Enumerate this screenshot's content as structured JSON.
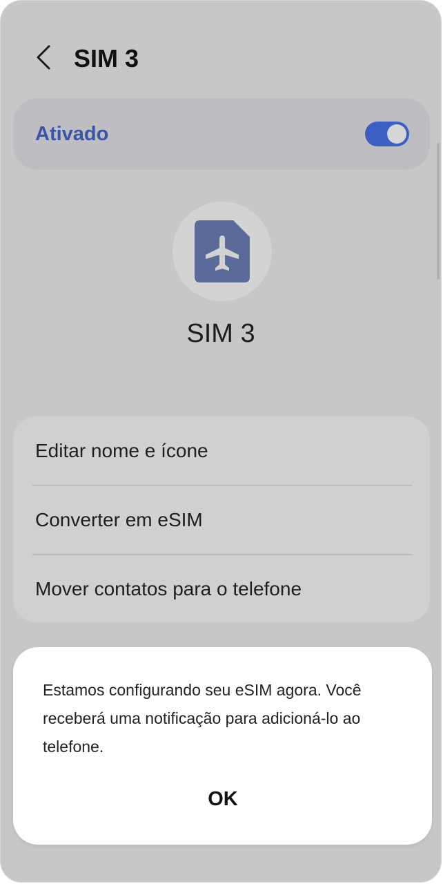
{
  "header": {
    "title": "SIM 3",
    "back_icon": "chevron-left-icon"
  },
  "toggle": {
    "label": "Ativado",
    "state": "on",
    "accent_color": "#3b5fc4"
  },
  "sim": {
    "icon": "sim-card-airplane-icon",
    "name": "SIM 3"
  },
  "menu": {
    "items": [
      {
        "label": "Editar nome e ícone"
      },
      {
        "label": "Converter em eSIM"
      },
      {
        "label": "Mover contatos para o telefone"
      }
    ]
  },
  "dialog": {
    "message": "Estamos configurando seu eSIM agora. Você receberá uma notificação para adicioná-lo ao telefone.",
    "ok_label": "OK"
  }
}
